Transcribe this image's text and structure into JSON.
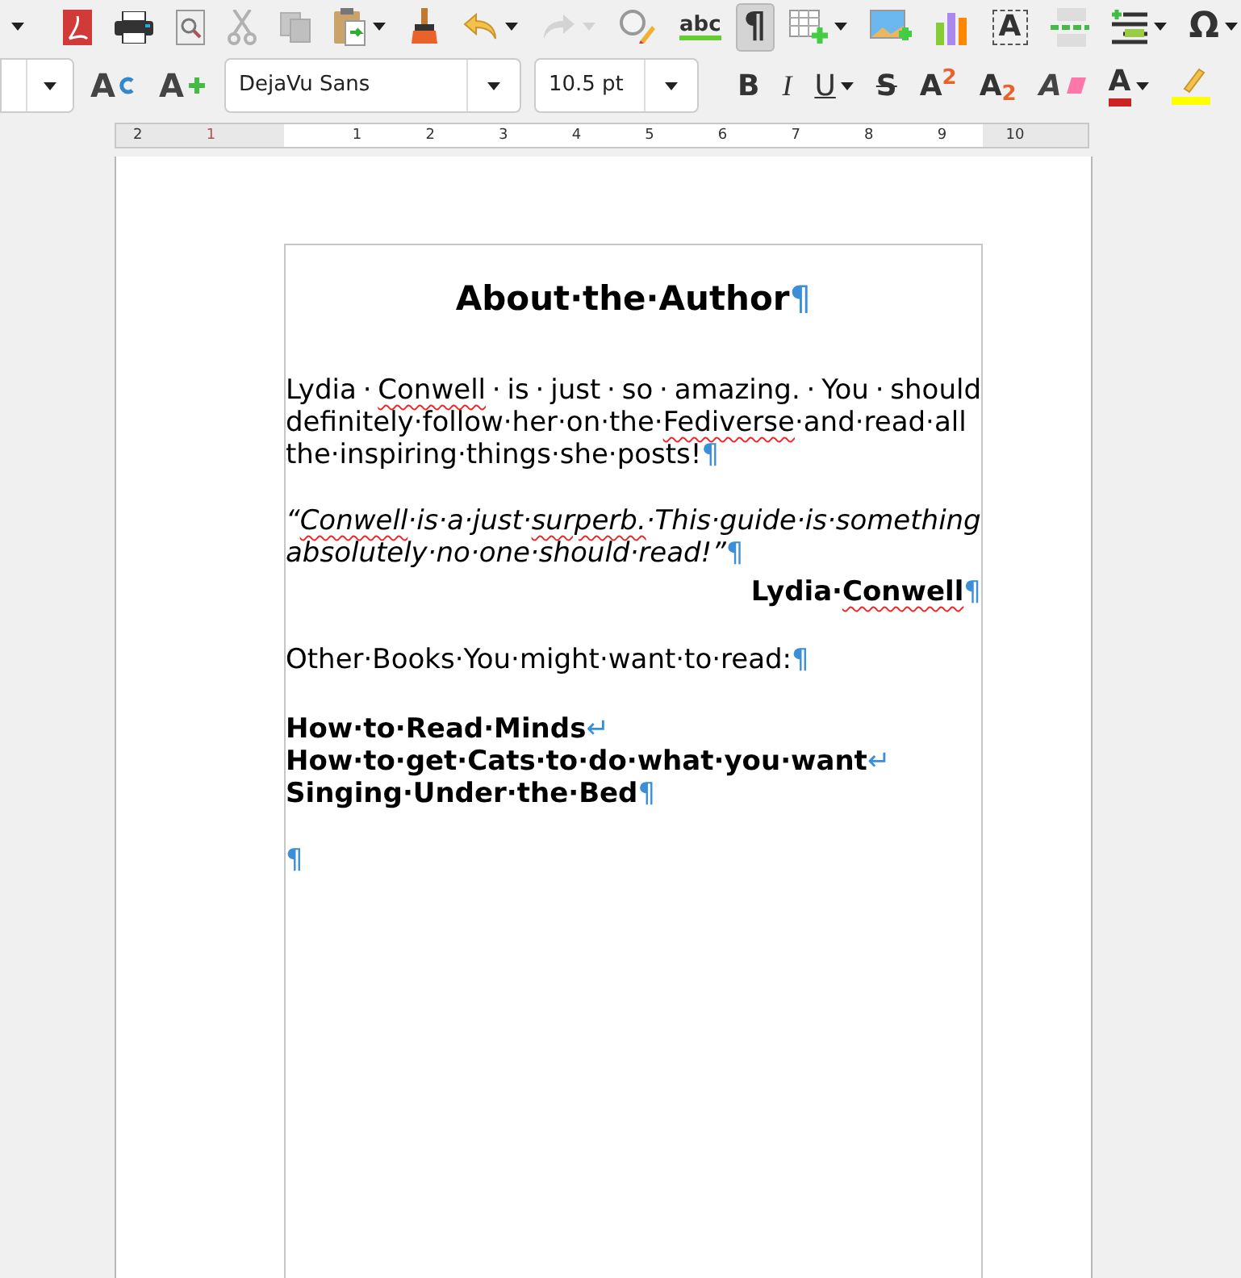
{
  "standard_toolbar": [
    {
      "kind": "caret",
      "disabled": false,
      "selected": false,
      "dropdown": false
    },
    {
      "kind": "pdf",
      "disabled": false,
      "selected": false,
      "dropdown": false
    },
    {
      "kind": "print",
      "disabled": false,
      "selected": false,
      "dropdown": false
    },
    {
      "kind": "preview",
      "disabled": false,
      "selected": false,
      "dropdown": false
    },
    {
      "kind": "cut",
      "disabled": true,
      "selected": false,
      "dropdown": false
    },
    {
      "kind": "copy",
      "disabled": true,
      "selected": false,
      "dropdown": false
    },
    {
      "kind": "paste",
      "disabled": false,
      "selected": false,
      "dropdown": true
    },
    {
      "kind": "clone",
      "disabled": false,
      "selected": false,
      "dropdown": false
    },
    {
      "kind": "undo",
      "disabled": false,
      "selected": false,
      "dropdown": true
    },
    {
      "kind": "redo",
      "disabled": true,
      "selected": false,
      "dropdown": true
    },
    {
      "kind": "find",
      "disabled": false,
      "selected": false,
      "dropdown": false
    },
    {
      "kind": "spelling",
      "label": "abc",
      "disabled": false,
      "selected": false,
      "dropdown": false
    },
    {
      "kind": "marks",
      "label": "¶",
      "disabled": false,
      "selected": true,
      "dropdown": false
    },
    {
      "kind": "table",
      "disabled": false,
      "selected": false,
      "dropdown": true
    },
    {
      "kind": "image",
      "disabled": false,
      "selected": false,
      "dropdown": false
    },
    {
      "kind": "chart",
      "disabled": false,
      "selected": false,
      "dropdown": false
    },
    {
      "kind": "textbox",
      "label": "A",
      "disabled": false,
      "selected": false,
      "dropdown": false
    },
    {
      "kind": "pagebreak",
      "disabled": false,
      "selected": false,
      "dropdown": false
    },
    {
      "kind": "field",
      "disabled": false,
      "selected": false,
      "dropdown": true
    },
    {
      "kind": "special",
      "label": "Ω",
      "disabled": false,
      "selected": false,
      "dropdown": true
    }
  ],
  "formatting_toolbar": {
    "font_name": "DejaVu Sans",
    "font_size": "10.5 pt",
    "buttons": [
      {
        "kind": "update-style",
        "label": "A",
        "dropdown": false
      },
      {
        "kind": "new-style",
        "label": "A",
        "dropdown": false
      },
      {
        "kind": "bold",
        "label": "B",
        "dropdown": false
      },
      {
        "kind": "italic",
        "label": "I",
        "dropdown": false
      },
      {
        "kind": "underline",
        "label": "U",
        "dropdown": true
      },
      {
        "kind": "strike",
        "label": "S",
        "dropdown": false
      },
      {
        "kind": "superscript",
        "label": "A$^{2}$",
        "dropdown": false
      },
      {
        "kind": "subscript",
        "label": "A$_{2}$",
        "dropdown": false
      },
      {
        "kind": "clear",
        "label": "A",
        "dropdown": false
      },
      {
        "kind": "font-color",
        "label": "A",
        "dropdown": true
      },
      {
        "kind": "highlight",
        "dropdown": false
      }
    ]
  },
  "ruler": {
    "labels": [
      "2",
      "1",
      "1",
      "2",
      "3",
      "4",
      "5",
      "6",
      "7",
      "8",
      "9",
      "10"
    ]
  },
  "document": {
    "paragraphs": [
      {
        "kind": "heading",
        "lines": [
          {
            "segments": [
              {
                "text": "About·the·Author",
                "misspelled": false
              }
            ],
            "end_mark": "¶"
          }
        ]
      },
      {
        "kind": "body",
        "lines": [
          {
            "segments": [
              {
                "text": "Lydia · ",
                "misspelled": false
              },
              {
                "text": "Conwell",
                "misspelled": true
              },
              {
                "text": " · is · just · so · amazing. · You · should",
                "misspelled": false
              }
            ]
          },
          {
            "segments": [
              {
                "text": "definitely·follow·her·on·the·",
                "misspelled": false
              },
              {
                "text": "Fediverse",
                "misspelled": true
              },
              {
                "text": "·and·read·all",
                "misspelled": false
              }
            ]
          },
          {
            "segments": [
              {
                "text": "the·inspiring·things·she·posts!",
                "misspelled": false
              }
            ],
            "end_mark": "¶"
          }
        ]
      },
      {
        "kind": "quote",
        "lines": [
          {
            "segments": [
              {
                "text": "“",
                "misspelled": false
              },
              {
                "text": "Conwell",
                "misspelled": true
              },
              {
                "text": "·is·a·just·",
                "misspelled": false
              },
              {
                "text": "surperb.",
                "misspelled": true
              },
              {
                "text": "·This·guide·is·something",
                "misspelled": false
              }
            ]
          },
          {
            "segments": [
              {
                "text": "absolutely·no·one·should·read!”",
                "misspelled": false
              }
            ],
            "end_mark": "¶"
          }
        ]
      },
      {
        "kind": "attribution",
        "lines": [
          {
            "segments": [
              {
                "text": "Lydia·",
                "misspelled": false
              },
              {
                "text": "Conwell",
                "misspelled": true
              }
            ],
            "end_mark": "¶"
          }
        ]
      },
      {
        "kind": "plain",
        "lines": [
          {
            "segments": [
              {
                "text": "Other·Books·You·might·want·to·read:",
                "misspelled": false
              }
            ],
            "end_mark": "¶"
          }
        ]
      },
      {
        "kind": "list",
        "lines": [
          {
            "segments": [
              {
                "text": "How·to·Read·Minds",
                "misspelled": false
              }
            ],
            "end_mark": "↵"
          },
          {
            "segments": [
              {
                "text": "How·to·get·Cats·to·do·what·you·want",
                "misspelled": false
              }
            ],
            "end_mark": "↵"
          },
          {
            "segments": [
              {
                "text": "Singing·Under·the·Bed",
                "misspelled": false
              }
            ],
            "end_mark": "¶"
          }
        ]
      },
      {
        "kind": "plain",
        "lines": [
          {
            "end_mark": "¶"
          }
        ]
      }
    ]
  }
}
